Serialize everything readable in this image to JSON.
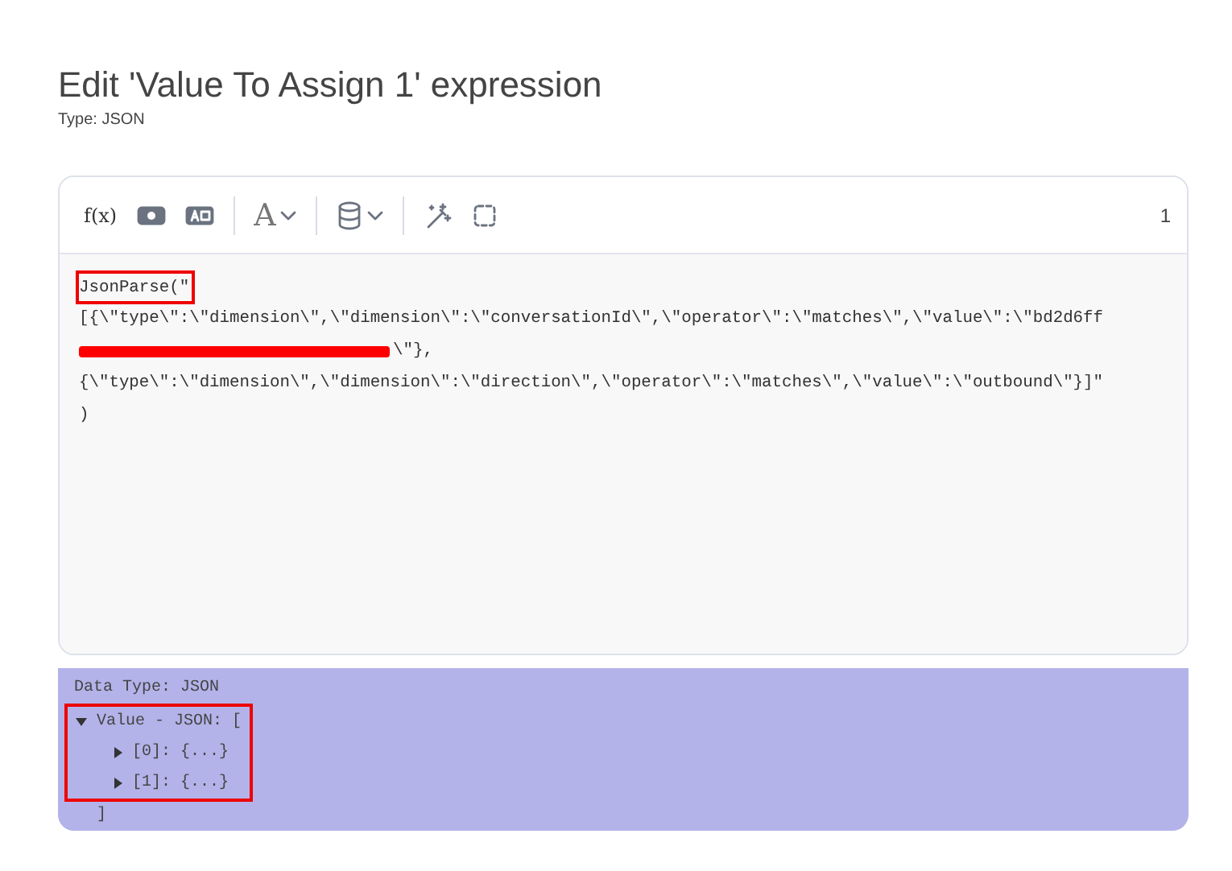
{
  "title": "Edit 'Value To Assign 1' expression",
  "subtitle": "Type: JSON",
  "toolbar": [
    {
      "kind": "text",
      "label": "f(x)"
    },
    {
      "kind": "icon"
    },
    {
      "kind": "icon"
    },
    {
      "kind": "divider"
    },
    {
      "kind": "text-dropdown",
      "label": "A"
    },
    {
      "kind": "divider"
    },
    {
      "kind": "icon-dropdown"
    },
    {
      "kind": "divider"
    },
    {
      "kind": "icon"
    },
    {
      "kind": "icon"
    }
  ],
  "line_count": "1",
  "code_lines": [
    {
      "text": "JsonParse(\"",
      "highlighted": true,
      "redacted": false
    },
    {
      "text": "[{\\\"type\\\":\\\"dimension\\\",\\\"dimension\\\":\\\"conversationId\\\",\\\"operator\\\":\\\"matches\\\",\\\"value\\\":\\\"bd2d6ff",
      "highlighted": false,
      "redacted": false
    },
    {
      "text": "\\\"},",
      "highlighted": false,
      "redacted": true
    },
    {
      "text": "{\\\"type\\\":\\\"dimension\\\",\\\"dimension\\\":\\\"direction\\\",\\\"operator\\\":\\\"matches\\\",\\\"value\\\":\\\"outbound\\\"}]\"",
      "highlighted": false,
      "redacted": false
    },
    {
      "text": ")",
      "highlighted": false,
      "redacted": false
    }
  ],
  "result": {
    "data_type": "Data Type: JSON",
    "tree": {
      "label": "Value - JSON: [",
      "expanded": true,
      "highlighted": true,
      "children": [
        {
          "label": "[0]: {...}",
          "expanded": false
        },
        {
          "label": "[1]: {...}",
          "expanded": false
        }
      ],
      "closing": "]"
    }
  }
}
